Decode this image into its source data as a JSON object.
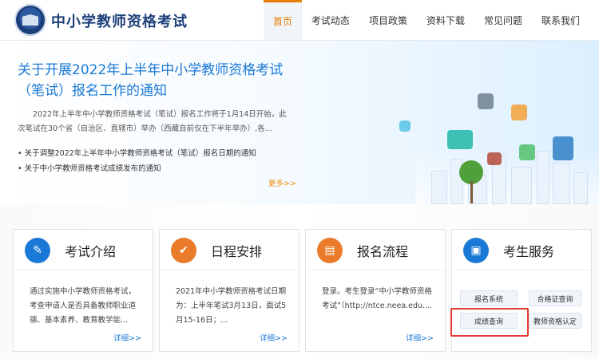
{
  "header": {
    "site_title": "中小学教师资格考试",
    "nav": [
      "首页",
      "考试动态",
      "项目政策",
      "资料下载",
      "常见问题",
      "联系我们"
    ],
    "active_index": 0
  },
  "banner": {
    "title": "关于开展2022年上半年中小学教师资格考试（笔试）报名工作的通知",
    "body": "2022年上半年中小学教师资格考试（笔试）报名工作将于1月14日开始，此次笔试在30个省（自治区、直辖市）举办（西藏自前仅在下半年举办）,各...",
    "links": [
      "关于调整2022年上半年中小学教师资格考试（笔试）报名日期的通知",
      "关于中小学教师资格考试成绩发布的通知"
    ],
    "more": "更多>>"
  },
  "cards": [
    {
      "title": "考试介绍",
      "icon": "edit-note-icon",
      "text": "通过实施中小学教师资格考试，考查申请人是否具备教师职业道德、基本素养、教育教学能...",
      "more": "详细>>"
    },
    {
      "title": "日程安排",
      "icon": "checkmark-icon",
      "text": "2021年中小学教师资格考试日期为：上半年笔试3月13日，面试5月15-16日；...",
      "more": "详细>>"
    },
    {
      "title": "报名流程",
      "icon": "form-icon",
      "text": "登录。考生登录“中小学教师资格考试”（http://ntce.neea.edu....",
      "more": "详细>>"
    }
  ],
  "service": {
    "title": "考生服务",
    "icon": "id-card-icon",
    "buttons": [
      "报名系统",
      "合格证查询",
      "成绩查询",
      "教师资格认定"
    ]
  },
  "colors": {
    "accent_blue": "#1a79d6",
    "accent_orange": "#e57f00",
    "highlight_red": "#e53935"
  }
}
